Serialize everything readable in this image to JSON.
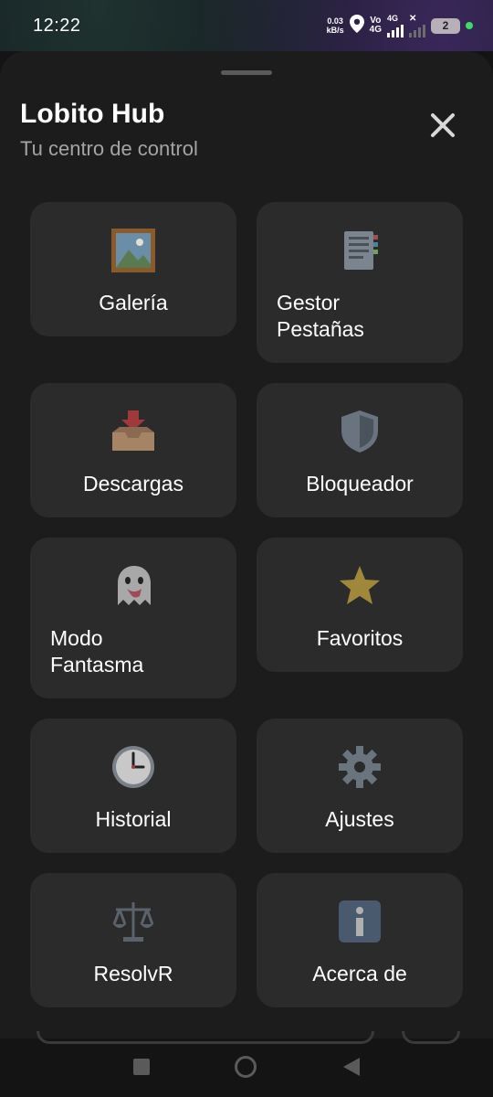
{
  "status_bar": {
    "time": "12:22",
    "net_speed_value": "0.03",
    "net_speed_unit": "kB/s",
    "volte_top": "Vo",
    "volte_bottom": "4G",
    "network_label": "4G",
    "battery_level": "2"
  },
  "sheet": {
    "title": "Lobito Hub",
    "subtitle": "Tu centro de control"
  },
  "tiles": [
    {
      "label": "Galería",
      "icon": "framed-picture-icon"
    },
    {
      "label": "Gestor\nPestañas",
      "icon": "bookmark-tabs-icon"
    },
    {
      "label": "Descargas",
      "icon": "inbox-tray-icon"
    },
    {
      "label": "Bloqueador",
      "icon": "shield-icon"
    },
    {
      "label": "Modo\nFantasma",
      "icon": "ghost-icon"
    },
    {
      "label": "Favoritos",
      "icon": "star-icon"
    },
    {
      "label": "Historial",
      "icon": "clock-icon"
    },
    {
      "label": "Ajustes",
      "icon": "gear-icon"
    },
    {
      "label": "ResolvR",
      "icon": "balance-scale-icon"
    },
    {
      "label": "Acerca de",
      "icon": "information-icon"
    }
  ],
  "colors": {
    "sheet_background": "#1c1c1c",
    "tile_background": "#2b2b2b",
    "subtitle_text": "#a4a4a4",
    "status_dot": "#3ddc64"
  }
}
